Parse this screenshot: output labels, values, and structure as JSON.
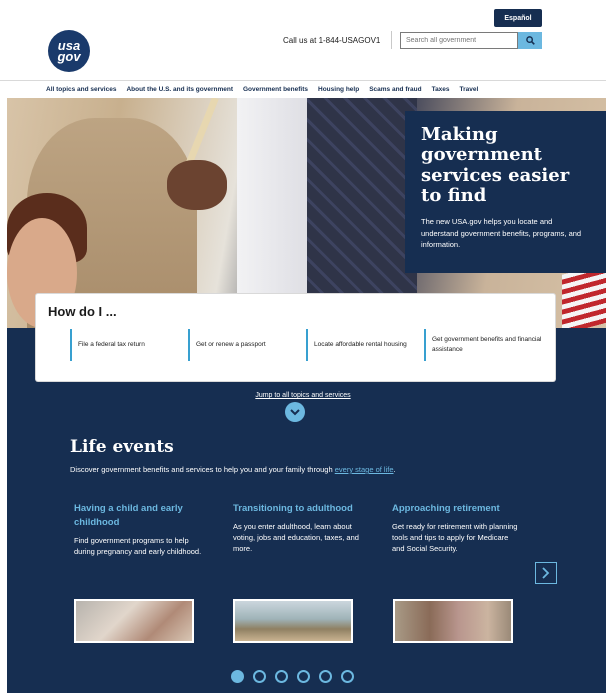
{
  "header": {
    "espanol_label": "Español",
    "logo_line1": "usa",
    "logo_line2": "gov",
    "call_text": "Call us at 1-844-USAGOV1",
    "search_placeholder": "Search all government"
  },
  "nav": {
    "items": [
      "All topics and services",
      "About the U.S. and its government",
      "Government benefits",
      "Housing help",
      "Scams and fraud",
      "Taxes",
      "Travel"
    ]
  },
  "hero": {
    "title": "Making government services easier to find",
    "description": "The new USA.gov helps you locate and understand government benefits, programs, and information."
  },
  "how_do_i": {
    "title": "How do I ...",
    "links": [
      "File a federal tax return",
      "Get or renew a passport",
      "Locate affordable rental housing",
      "Get government benefits and financial assistance"
    ]
  },
  "jump_link": "Jump to all topics and services",
  "life_events": {
    "title": "Life events",
    "description": "Discover government benefits and services to help you and your family through ",
    "description_link": "every stage of life",
    "description_end": ".",
    "events": [
      {
        "title": "Having a child and early childhood",
        "text": "Find government programs to help during pregnancy and early childhood."
      },
      {
        "title": "Transitioning to adulthood",
        "text": "As you enter adulthood, learn about voting, jobs and education, taxes, and more."
      },
      {
        "title": "Approaching retirement",
        "text": "Get ready for retirement with planning tools and tips to apply for Medicare and Social Security."
      }
    ]
  },
  "carousel": {
    "total_pages": 6,
    "active_page": 1
  },
  "colors": {
    "navy": "#162e51",
    "accent": "#6cb8e0"
  },
  "icons": {
    "search": "search-icon",
    "jump": "chevron-down-icon",
    "next": "chevron-right-icon"
  }
}
